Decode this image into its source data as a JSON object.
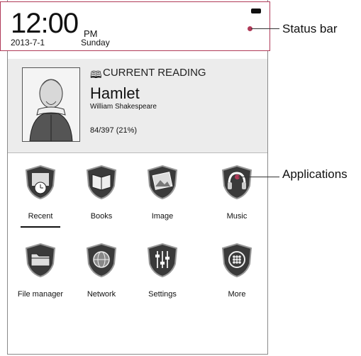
{
  "status_bar": {
    "time": "12:00",
    "ampm": "PM",
    "date": "2013-7-1",
    "day": "Sunday"
  },
  "reading": {
    "label": "CURRENT READING",
    "title": "Hamlet",
    "author": "William Shakespeare",
    "progress": "84/397 (21%)"
  },
  "apps": [
    {
      "label": "Recent",
      "icon": "recent-icon"
    },
    {
      "label": "Books",
      "icon": "books-icon"
    },
    {
      "label": "Image",
      "icon": "image-icon"
    },
    {
      "label": "Music",
      "icon": "music-icon"
    },
    {
      "label": "File manager",
      "icon": "file-manager-icon"
    },
    {
      "label": "Network",
      "icon": "network-icon"
    },
    {
      "label": "Settings",
      "icon": "settings-icon"
    },
    {
      "label": "More",
      "icon": "more-icon"
    }
  ],
  "callouts": {
    "status": "Status bar",
    "apps": "Applications"
  },
  "colors": {
    "callout": "#b03a58",
    "panel": "#ececec"
  }
}
